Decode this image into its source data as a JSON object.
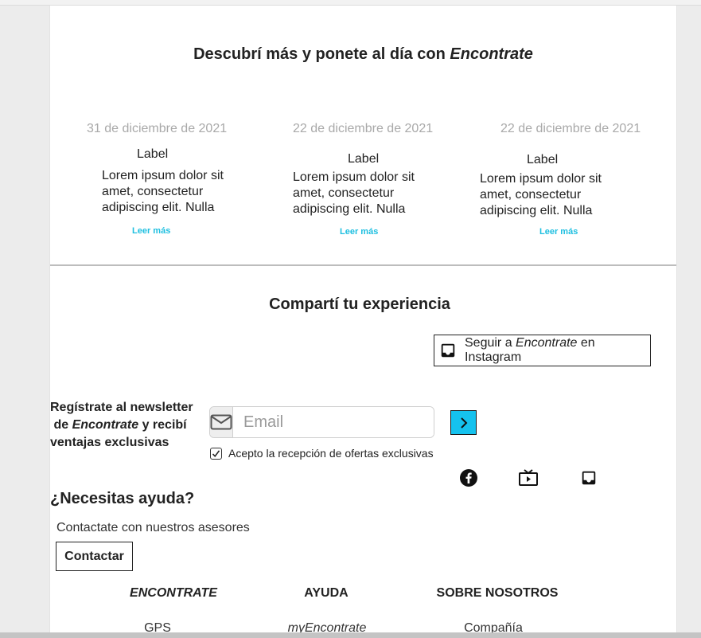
{
  "news": {
    "title_prefix": "Descubrí más y ponete al día con ",
    "title_brand": "Encontrate",
    "articles": [
      {
        "date": "31 de diciembre de 2021",
        "label": "Label",
        "text": "Lorem ipsum dolor sit amet, consectetur adipiscing elit. Nulla",
        "more": "Leer más"
      },
      {
        "date": "22 de diciembre de 2021",
        "label": "Label",
        "text": "Lorem ipsum dolor sit amet, consectetur adipiscing elit. Nulla",
        "more": "Leer más"
      },
      {
        "date": "22 de diciembre de 2021",
        "label": "Label",
        "text": "Lorem ipsum dolor sit amet, consectetur adipiscing elit. Nulla",
        "more": "Leer más"
      }
    ]
  },
  "share": {
    "title": "Compartí tu experiencia",
    "instagram_prefix": "Seguir a ",
    "instagram_brand": "Encontrate",
    "instagram_suffix": " en Instagram"
  },
  "newsletter": {
    "line1": "Regístrate al newsletter",
    "line2_prefix": " de ",
    "line2_brand": "Encontrate",
    "line2_suffix": " y recibí",
    "line3": "ventajas exclusivas",
    "email_placeholder": "Email",
    "email_value": "",
    "accept_label": "Acepto la recepción de ofertas exclusivas",
    "accept_checked": true
  },
  "social_icons": [
    "facebook-icon",
    "tv-icon",
    "inbox-icon"
  ],
  "help": {
    "title": "¿Necesitas ayuda?",
    "subtitle": "Contactate con nuestros asesores",
    "contact_button": "Contactar"
  },
  "footer": {
    "columns": [
      {
        "heading": "ENCONTRATE",
        "items": [
          "GPS"
        ]
      },
      {
        "heading": "AYUDA",
        "items": [
          "myEncontrate"
        ]
      },
      {
        "heading": "SOBRE NOSOTROS",
        "items": [
          "Compañía"
        ]
      }
    ]
  },
  "colors": {
    "accent": "#15c2ee",
    "link": "#1ebfe0",
    "divider": "#bdbdbd",
    "date": "#a9a9a9"
  }
}
